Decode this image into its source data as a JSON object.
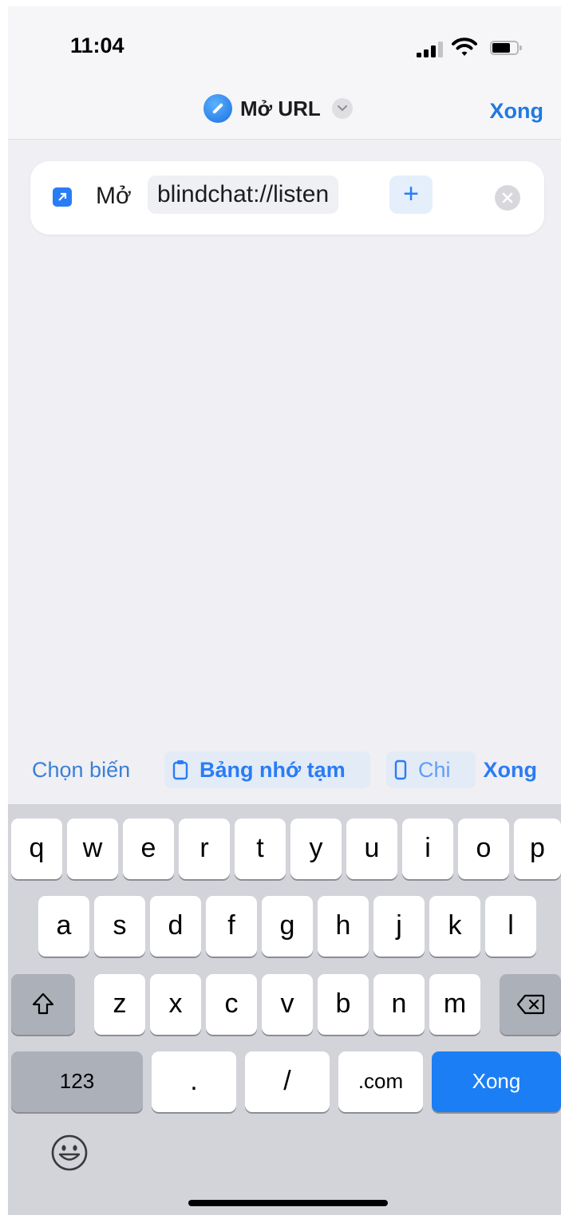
{
  "status_bar": {
    "time": "11:04"
  },
  "nav": {
    "title": "Mở URL",
    "done_label": "Xong"
  },
  "action": {
    "verb": "Mở",
    "url_value": "blindchat://listen",
    "add_label": "+"
  },
  "suggestions": {
    "choose_variable": "Chọn biến",
    "clipboard": "Bảng nhớ tạm",
    "device": "Chi",
    "done_label": "Xong"
  },
  "keyboard": {
    "row1": [
      "q",
      "w",
      "e",
      "r",
      "t",
      "y",
      "u",
      "i",
      "o",
      "p"
    ],
    "row2": [
      "a",
      "s",
      "d",
      "f",
      "g",
      "h",
      "j",
      "k",
      "l"
    ],
    "row3": [
      "z",
      "x",
      "c",
      "v",
      "b",
      "n",
      "m"
    ],
    "numbers_label": "123",
    "dot_label": ".",
    "slash_label": "/",
    "com_label": ".com",
    "return_label": "Xong"
  },
  "colors": {
    "accent": "#1f7ae0",
    "return_key": "#1b7ef5"
  }
}
